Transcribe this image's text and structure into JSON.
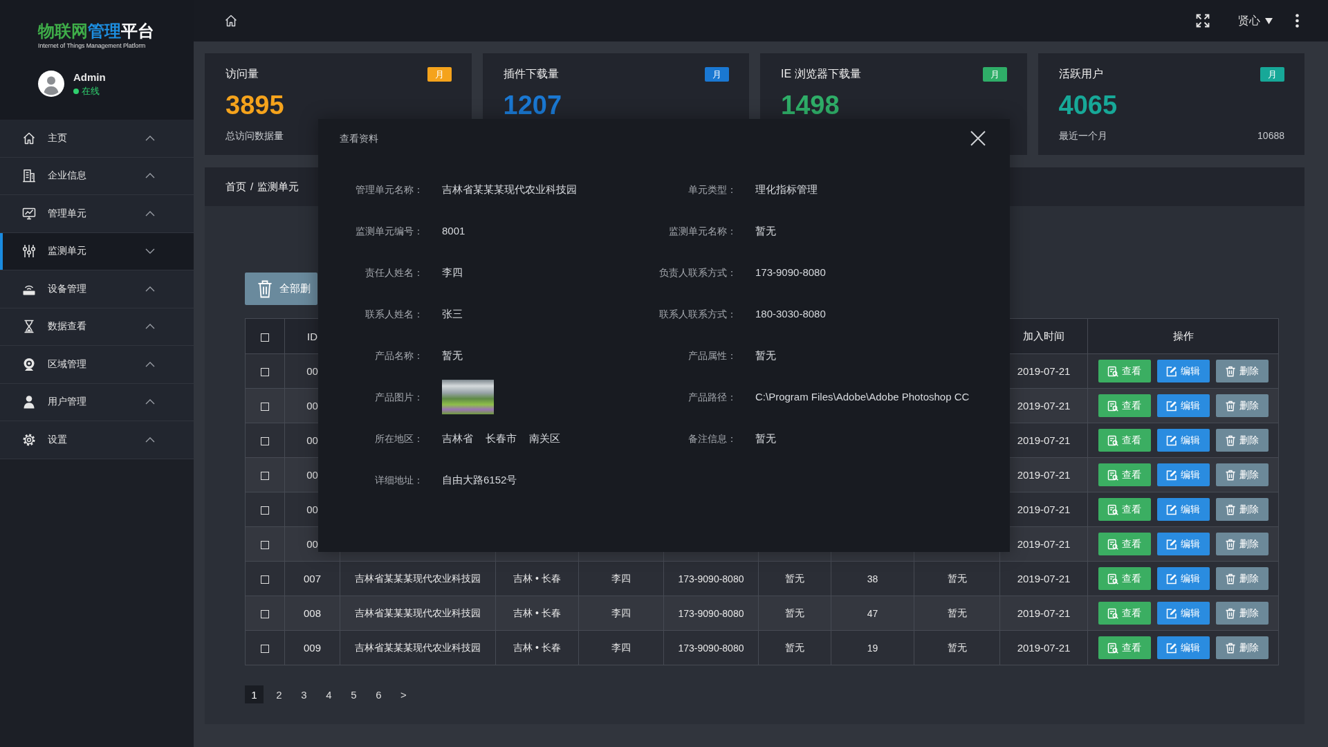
{
  "sidebar": {
    "logo": {
      "title_parts": [
        {
          "text": "物联网",
          "color": "#3fae49"
        },
        {
          "text": "管理",
          "color": "#1d8fe1"
        },
        {
          "text": "平台",
          "color": "#ffffff"
        }
      ],
      "subtitle": "Internet of Things Management Platform"
    },
    "user": {
      "name": "Admin",
      "status": "在线",
      "online": true
    },
    "items": [
      {
        "label": "主页",
        "selected": false,
        "expanded": false
      },
      {
        "label": "企业信息",
        "selected": false,
        "expanded": false
      },
      {
        "label": "管理单元",
        "selected": false,
        "expanded": false
      },
      {
        "label": "监测单元",
        "selected": true,
        "expanded": true
      },
      {
        "label": "设备管理",
        "selected": false,
        "expanded": false
      },
      {
        "label": "数据查看",
        "selected": false,
        "expanded": false
      },
      {
        "label": "区域管理",
        "selected": false,
        "expanded": false
      },
      {
        "label": "用户管理",
        "selected": false,
        "expanded": false
      },
      {
        "label": "设置",
        "selected": false,
        "expanded": false
      }
    ]
  },
  "top_bar": {
    "user_name": "贤心"
  },
  "stats": [
    {
      "title": "访问量",
      "badge": "月",
      "color": "#f5a31c",
      "value": "3895",
      "footer_label": "总访问数据量"
    },
    {
      "title": "插件下载量",
      "badge": "月",
      "color": "#1a78d2",
      "value": "1207"
    },
    {
      "title": "IE 浏览器下载量",
      "badge": "月",
      "color": "#2fae68",
      "value": "1498"
    },
    {
      "title": "活跃用户",
      "badge": "月",
      "color": "#17a898",
      "value": "4065",
      "footer_label": "最近一个月",
      "footer_value": "10688"
    }
  ],
  "breadcrumb": {
    "items": [
      {
        "label": "首页"
      },
      {
        "label": "监测单元"
      }
    ],
    "separator": "/"
  },
  "toolbar": {
    "delete_all": "全部删"
  },
  "table": {
    "select_all_checked": false,
    "headers": {
      "id": "ID",
      "date": "加入时间",
      "actions": "操作"
    },
    "rows": [
      {
        "checked": false,
        "id": "00",
        "date": "2019-07-21",
        "actions": [
          {
            "kind": "view",
            "label": "查看"
          },
          {
            "kind": "edit",
            "label": "编辑"
          },
          {
            "kind": "delete",
            "label": "删除"
          }
        ]
      },
      {
        "checked": false,
        "id": "00",
        "date": "2019-07-21",
        "actions": [
          {
            "kind": "view",
            "label": "查看"
          },
          {
            "kind": "edit",
            "label": "编辑"
          },
          {
            "kind": "delete",
            "label": "删除"
          }
        ]
      },
      {
        "checked": false,
        "id": "00",
        "date": "2019-07-21",
        "actions": [
          {
            "kind": "view",
            "label": "查看"
          },
          {
            "kind": "edit",
            "label": "编辑"
          },
          {
            "kind": "delete",
            "label": "删除"
          }
        ]
      },
      {
        "checked": false,
        "id": "00",
        "date": "2019-07-21",
        "actions": [
          {
            "kind": "view",
            "label": "查看"
          },
          {
            "kind": "edit",
            "label": "编辑"
          },
          {
            "kind": "delete",
            "label": "删除"
          }
        ]
      },
      {
        "checked": false,
        "id": "00",
        "date": "2019-07-21",
        "actions": [
          {
            "kind": "view",
            "label": "查看"
          },
          {
            "kind": "edit",
            "label": "编辑"
          },
          {
            "kind": "delete",
            "label": "删除"
          }
        ]
      },
      {
        "checked": false,
        "id": "00",
        "date": "2019-07-21",
        "actions": [
          {
            "kind": "view",
            "label": "查看"
          },
          {
            "kind": "edit",
            "label": "编辑"
          },
          {
            "kind": "delete",
            "label": "删除"
          }
        ]
      },
      {
        "checked": false,
        "id": "007",
        "cells": [
          "吉林省某某某现代农业科技园",
          "吉林 • 长春",
          "李四",
          "173-9090-8080",
          "暂无",
          "38",
          "暂无"
        ],
        "date": "2019-07-21",
        "actions": [
          {
            "kind": "view",
            "label": "查看"
          },
          {
            "kind": "edit",
            "label": "编辑"
          },
          {
            "kind": "delete",
            "label": "删除"
          }
        ]
      },
      {
        "checked": false,
        "id": "008",
        "cells": [
          "吉林省某某某现代农业科技园",
          "吉林 • 长春",
          "李四",
          "173-9090-8080",
          "暂无",
          "47",
          "暂无"
        ],
        "date": "2019-07-21",
        "actions": [
          {
            "kind": "view",
            "label": "查看"
          },
          {
            "kind": "edit",
            "label": "编辑"
          },
          {
            "kind": "delete",
            "label": "删除"
          }
        ]
      },
      {
        "checked": false,
        "id": "009",
        "cells": [
          "吉林省某某某现代农业科技园",
          "吉林 • 长春",
          "李四",
          "173-9090-8080",
          "暂无",
          "19",
          "暂无"
        ],
        "date": "2019-07-21",
        "actions": [
          {
            "kind": "view",
            "label": "查看"
          },
          {
            "kind": "edit",
            "label": "编辑"
          },
          {
            "kind": "delete",
            "label": "删除"
          }
        ]
      }
    ]
  },
  "pagination": {
    "pages": [
      {
        "label": "1",
        "selected": true
      },
      {
        "label": "2",
        "selected": false
      },
      {
        "label": "3",
        "selected": false
      },
      {
        "label": "4",
        "selected": false
      },
      {
        "label": "5",
        "selected": false
      },
      {
        "label": "6",
        "selected": false
      }
    ],
    "next": ">"
  },
  "modal": {
    "title": "查看资料",
    "rows": [
      [
        {
          "label": "管理单元名称：",
          "kind": "text",
          "value": "吉林省某某某现代农业科技园"
        },
        {
          "label": "单元类型：",
          "kind": "text",
          "value": "理化指标管理"
        }
      ],
      [
        {
          "label": "监测单元编号：",
          "kind": "text",
          "value": "8001"
        },
        {
          "label": "监测单元名称：",
          "kind": "text",
          "value": "暂无"
        }
      ],
      [
        {
          "label": "责任人姓名：",
          "kind": "text",
          "value": "李四"
        },
        {
          "label": "负责人联系方式：",
          "kind": "text",
          "value": "173-9090-8080"
        }
      ],
      [
        {
          "label": "联系人姓名：",
          "kind": "text",
          "value": "张三"
        },
        {
          "label": "联系人联系方式：",
          "kind": "text",
          "value": "180-3030-8080"
        }
      ],
      [
        {
          "label": "产品名称：",
          "kind": "text",
          "value": "暂无"
        },
        {
          "label": "产品属性：",
          "kind": "text",
          "value": "暂无"
        }
      ],
      [
        {
          "label": "产品图片：",
          "kind": "image"
        },
        {
          "label": "产品路径：",
          "kind": "text",
          "value": "C:\\Program Files\\Adobe\\Adobe Photoshop CC"
        }
      ],
      [
        {
          "label": "所在地区：",
          "kind": "parts",
          "values": [
            "吉林省",
            "长春市",
            "南关区"
          ]
        },
        {
          "label": "备注信息：",
          "kind": "text",
          "value": "暂无"
        }
      ],
      [
        {
          "label": "详细地址：",
          "kind": "text",
          "value": "自由大路6152号"
        }
      ]
    ]
  }
}
